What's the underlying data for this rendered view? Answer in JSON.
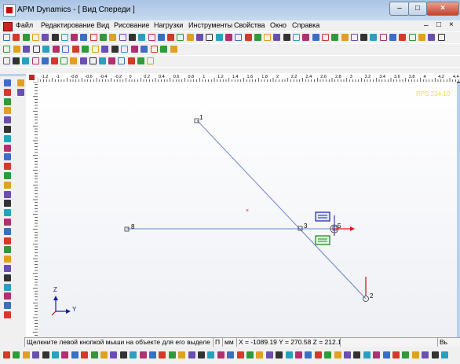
{
  "window": {
    "title": "APM Dynamics - [ Вид Спереди ]"
  },
  "menu": [
    "Файл",
    "Редактирование",
    "Вид",
    "Рисование",
    "Нагрузки",
    "Инструменты",
    "Свойства",
    "Окно",
    "Справка"
  ],
  "mdi_controls": [
    "–",
    "□",
    "×"
  ],
  "canvas": {
    "corner_label": "RPS 234.10",
    "node_labels": [
      "1",
      "8",
      "3",
      "5",
      "2"
    ],
    "center_marker": "×",
    "axes": {
      "z": "Z",
      "y": "Y"
    },
    "colors": {
      "member": "#6a7fd0",
      "load": "#e01818",
      "highlight_blue": "#2020a0",
      "highlight_green": "#108010"
    }
  },
  "ruler_top": [
    "-1.2",
    "-1",
    "-0.8",
    "-0.6",
    "-0.4",
    "-0.2",
    "0",
    "0.2",
    "0.4",
    "0.6",
    "0.8",
    "1",
    "1.2",
    "1.4",
    "1.6",
    "1.8",
    "2",
    "2.2",
    "2.4",
    "2.6",
    "2.8",
    "3",
    "3.2",
    "3.4",
    "3.6",
    "3.8",
    "4",
    "4.2",
    "4.4"
  ],
  "status": {
    "hint": "Щелкните левой кнопкой мыши на объекте для его выделе",
    "snap": "П",
    "units": "мм",
    "coords": "X = -1089.19 Y = 270.58 Z = 212.1",
    "extra": "Вь"
  }
}
